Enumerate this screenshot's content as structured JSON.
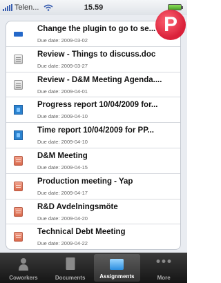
{
  "status_bar": {
    "carrier": "Telen...",
    "time": "15.59"
  },
  "badge": {
    "letter": "P",
    "color": "#e8172f"
  },
  "assignments": [
    {
      "icon": "plugin-icon",
      "title": "Change the plugin to go to se...",
      "due": "Due date: 2009-03-02"
    },
    {
      "icon": "document-icon",
      "title": "Review - Things to discuss.doc",
      "due": "Due date: 2009-03-27"
    },
    {
      "icon": "document-icon",
      "title": "Review - D&M Meeting Agenda....",
      "due": "Due date: 2009-04-01"
    },
    {
      "icon": "report-icon",
      "title": "Progress report 10/04/2009 for...",
      "due": "Due date: 2009-04-10"
    },
    {
      "icon": "report-icon",
      "title": "Time report 10/04/2009 for PP...",
      "due": "Due date: 2009-04-10"
    },
    {
      "icon": "meeting-icon",
      "title": "D&M Meeting",
      "due": "Due date: 2009-04-15"
    },
    {
      "icon": "meeting-icon",
      "title": "Production meeting - Yap",
      "due": "Due date: 2009-04-17"
    },
    {
      "icon": "meeting-icon",
      "title": "R&D Avdelningsmöte",
      "due": "Due date: 2009-04-20"
    },
    {
      "icon": "meeting-icon",
      "title": "Technical Debt Meeting",
      "due": "Due date: 2009-04-22"
    }
  ],
  "tab_bar": {
    "tabs": [
      {
        "label": "Coworkers",
        "icon": "people-icon"
      },
      {
        "label": "Documents",
        "icon": "documents-icon"
      },
      {
        "label": "Assignments",
        "icon": "assignments-icon",
        "active": true
      },
      {
        "label": "More",
        "icon": "more-icon"
      }
    ]
  }
}
